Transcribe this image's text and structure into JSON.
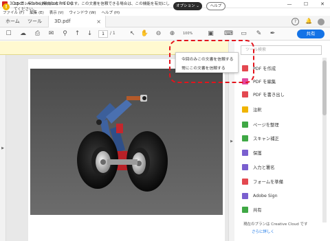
{
  "window": {
    "title": "3D.pdf - Adobe Acrobat Pro DC",
    "controls": [
      "—",
      "☐",
      "✕"
    ]
  },
  "menu": [
    "ファイル (F)",
    "編集 (E)",
    "表示 (V)",
    "ウィンドウ (W)",
    "ヘルプ (H)"
  ],
  "tabs": {
    "home": "ホーム",
    "tools": "ツール",
    "document": "3D.pdf",
    "close": "×",
    "help_icon": "?",
    "bell_icon": "🔔"
  },
  "toolbar": {
    "page_current": "1",
    "page_total": "/ 1",
    "zoom": "100%",
    "share": "共有"
  },
  "warning": {
    "text": "3D コンテンツは無効になっています。この文書を信頼できる場合は、この機能を有効にしてください。",
    "options_button": "オプション ⌄",
    "help_button": "ヘルプ"
  },
  "dropdown": {
    "items": [
      "今回のみこの文書を信頼する",
      "常にこの文書を信頼する"
    ]
  },
  "right_panel": {
    "search_placeholder": "ツール検索",
    "tools": [
      {
        "label": "PDF を作成",
        "icon": "create-pdf-icon",
        "color": "#e34850"
      },
      {
        "label": "PDF を編集",
        "icon": "edit-pdf-icon",
        "color": "#e2489f"
      },
      {
        "label": "PDF を書き出し",
        "icon": "export-pdf-icon",
        "color": "#e34850"
      },
      {
        "label": "注釈",
        "icon": "comment-icon",
        "color": "#f0b400"
      },
      {
        "label": "ページを整理",
        "icon": "organize-pages-icon",
        "color": "#3fa845"
      },
      {
        "label": "スキャン補正",
        "icon": "scan-icon",
        "color": "#3fa845"
      },
      {
        "label": "保護",
        "icon": "protect-icon",
        "color": "#7a5fcf"
      },
      {
        "label": "入力と署名",
        "icon": "fill-sign-icon",
        "color": "#7a5fcf"
      },
      {
        "label": "フォームを準備",
        "icon": "prepare-form-icon",
        "color": "#e34850"
      },
      {
        "label": "Adobe Sign",
        "icon": "adobe-sign-icon",
        "color": "#7a5fcf"
      },
      {
        "label": "共有",
        "icon": "share-icon",
        "color": "#3fa845"
      }
    ],
    "plan_text": "現在のプランは Creative Cloud です",
    "plan_link": "さらに詳しく"
  },
  "colors": {
    "accent": "#1473e6",
    "warning_bg": "#fff9d0",
    "highlight": "#e3141c"
  }
}
